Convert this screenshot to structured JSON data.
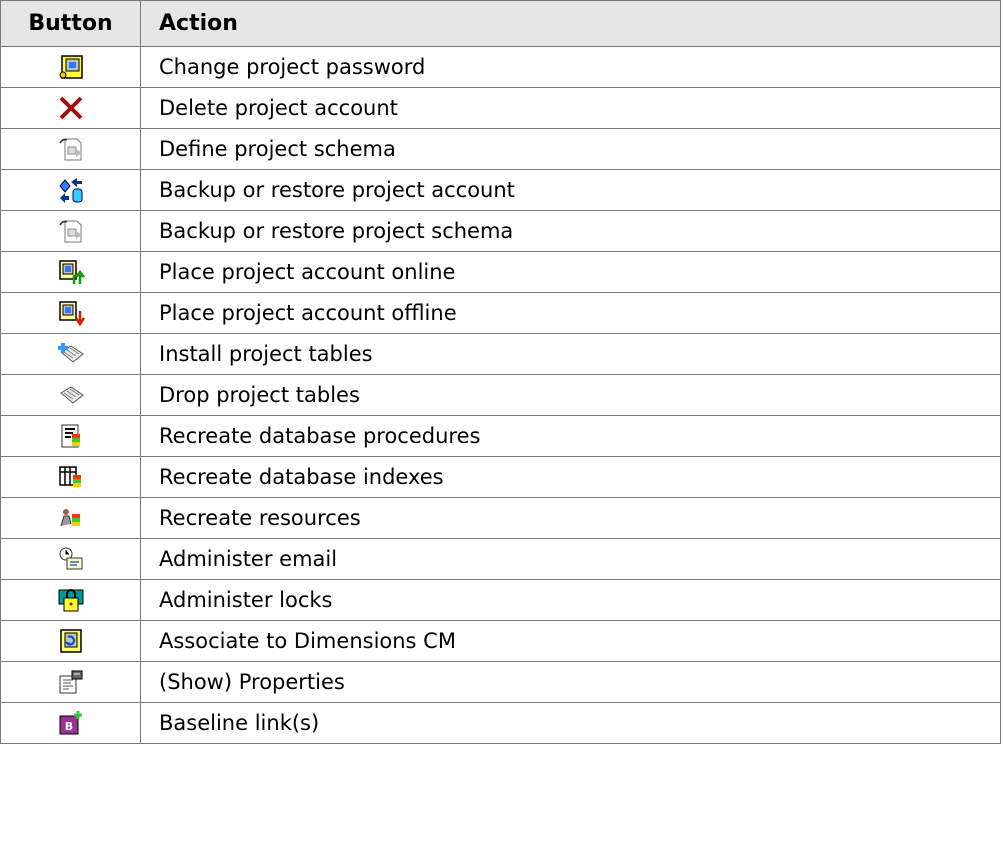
{
  "table": {
    "headers": [
      "Button",
      "Action"
    ],
    "rows": [
      {
        "icon": "project-password-icon",
        "action": "Change project password"
      },
      {
        "icon": "delete-x-icon",
        "action": "Delete project account"
      },
      {
        "icon": "schema-document-icon",
        "action": "Define project schema"
      },
      {
        "icon": "backup-restore-arrows-icon",
        "action": "Backup or restore project account"
      },
      {
        "icon": "schema-document-icon",
        "action": "Backup or restore project schema"
      },
      {
        "icon": "account-online-icon",
        "action": "Place project account online"
      },
      {
        "icon": "account-offline-icon",
        "action": "Place project account offline"
      },
      {
        "icon": "install-tables-icon",
        "action": "Install project tables"
      },
      {
        "icon": "drop-tables-icon",
        "action": "Drop project tables"
      },
      {
        "icon": "database-procedures-icon",
        "action": "Recreate database procedures"
      },
      {
        "icon": "database-indexes-icon",
        "action": "Recreate database indexes"
      },
      {
        "icon": "resources-icon",
        "action": "Recreate resources"
      },
      {
        "icon": "email-clock-icon",
        "action": "Administer email"
      },
      {
        "icon": "lock-icon",
        "action": "Administer locks"
      },
      {
        "icon": "dimensions-cm-icon",
        "action": "Associate to Dimensions CM"
      },
      {
        "icon": "properties-icon",
        "action": "(Show) Properties"
      },
      {
        "icon": "baseline-link-icon",
        "action": "Baseline link(s)"
      }
    ]
  }
}
